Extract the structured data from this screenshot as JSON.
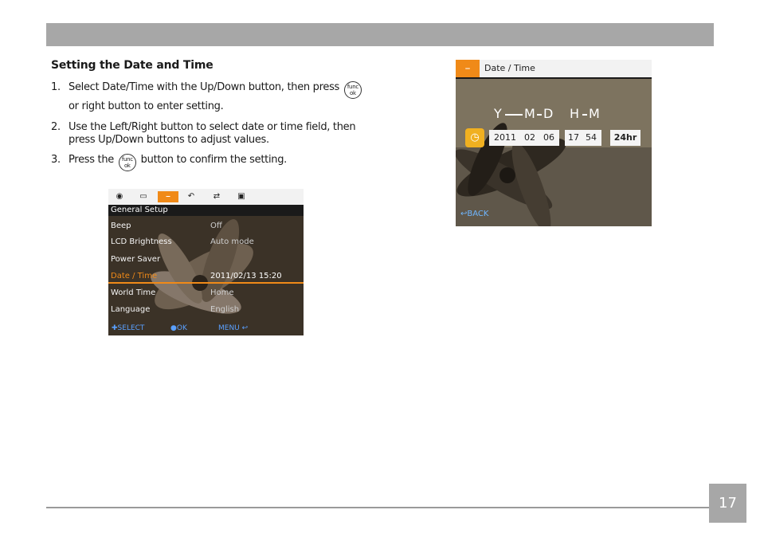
{
  "section_title": "Setting the Date and Time",
  "steps": [
    {
      "num": "1.",
      "line1_before": "Select Date/Time with the Up/Down button, then press",
      "line2": "or right button to enter setting."
    },
    {
      "num": "2.",
      "line1": "Use the Left/Right button to select date or time field, then",
      "line2": "press Up/Down buttons to adjust values."
    },
    {
      "num": "3.",
      "before": "Press the",
      "after": "button to confirm the setting."
    }
  ],
  "func_ok": {
    "top": "func",
    "bottom": "ok"
  },
  "screen1": {
    "tab_icons": [
      "camera-icon",
      "video-icon",
      "setup-key-icon",
      "playback-icon",
      "transfer-icon",
      "connect-icon"
    ],
    "header": "General Setup",
    "rows": [
      {
        "label": "Beep",
        "value": "Off"
      },
      {
        "label": "LCD Brightness",
        "value": "Auto mode"
      },
      {
        "label": "Power Saver",
        "value": ""
      },
      {
        "label": "Date / Time",
        "value": "2011/02/13  15:20"
      },
      {
        "label": "World Time",
        "value": "Home"
      },
      {
        "label": "Language",
        "value": "English"
      }
    ],
    "bottom": {
      "select": "SELECT",
      "ok": "OK",
      "menu": "MENU"
    }
  },
  "screen2": {
    "title": "Date / Time",
    "field_labels": {
      "y": "Y",
      "m": "M",
      "d": "D",
      "h": "H",
      "mi": "M"
    },
    "date": {
      "year": "2011",
      "month": "02",
      "day": "06"
    },
    "time": {
      "hour": "17",
      "minute": "54"
    },
    "format": "24hr",
    "back": "BACK"
  },
  "page_number": "17",
  "colors": {
    "accent": "#f08a18",
    "bar": "#a7a7a7"
  }
}
